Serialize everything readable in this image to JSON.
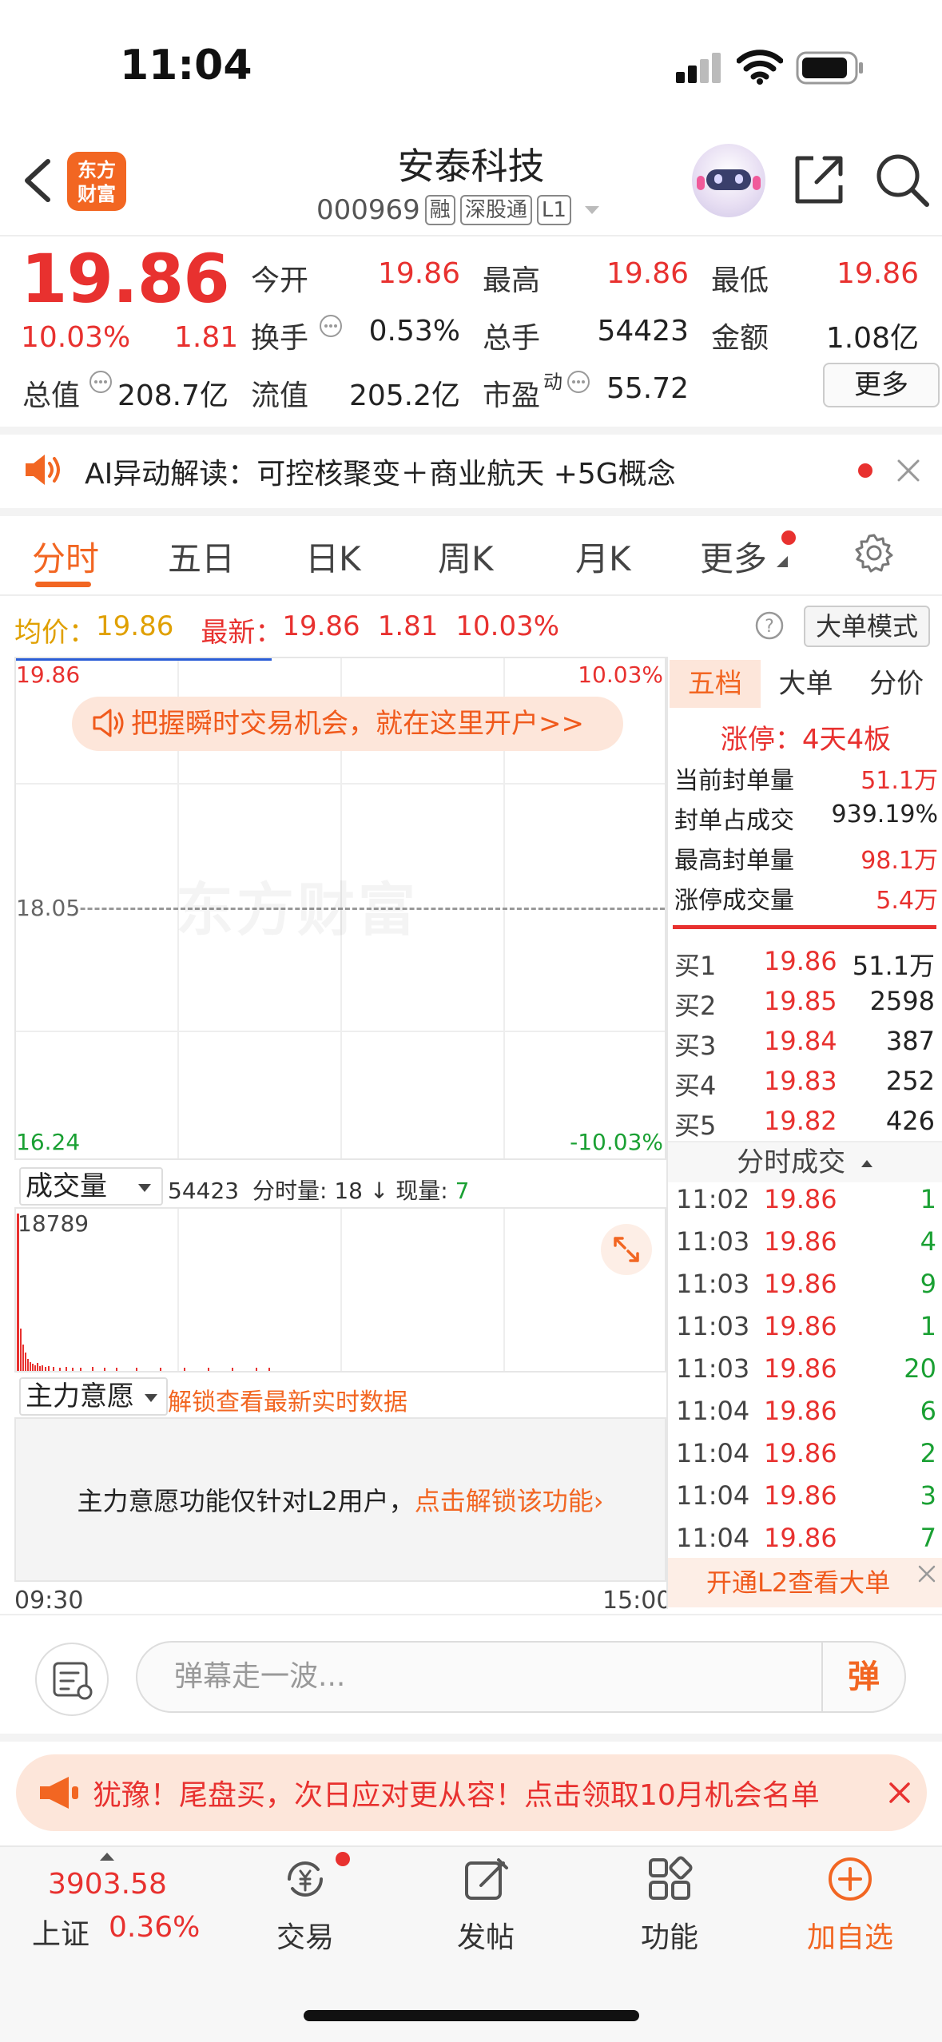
{
  "status_bar": {
    "time": "11:04"
  },
  "header": {
    "logo_text": "东方财富",
    "stock_name": "安泰科技",
    "stock_code": "000969",
    "tags": [
      "融",
      "深股通",
      "L1"
    ]
  },
  "quote": {
    "price": "19.86",
    "change_pct": "10.03%",
    "change": "1.81",
    "fields": {
      "open_label": "今开",
      "open": "19.86",
      "high_label": "最高",
      "high": "19.86",
      "low_label": "最低",
      "low": "19.86",
      "turnover_label": "换手",
      "turnover": "0.53%",
      "volume_label": "总手",
      "volume": "54423",
      "amount_label": "金额",
      "amount": "1.08亿",
      "total_cap_label": "总值",
      "total_cap": "208.7亿",
      "float_cap_label": "流值",
      "float_cap": "205.2亿",
      "pe_label": "市盈",
      "pe_sup": "动",
      "pe": "55.72"
    },
    "more_button": "更多"
  },
  "ai_bar": {
    "text": "AI异动解读：可控核聚变＋商业航天 +5G概念"
  },
  "tabs": [
    "分时",
    "五日",
    "日K",
    "周K",
    "月K",
    "更多"
  ],
  "info_line": {
    "avg_label": "均价：",
    "avg": "19.86",
    "latest_label": "最新：",
    "latest": "19.86",
    "change": "1.81",
    "pct": "10.03%",
    "mode_button": "大单模式"
  },
  "chart": {
    "top_price": "19.86",
    "top_pct": "10.03%",
    "mid_price": "18.05",
    "bottom_price": "16.24",
    "bottom_pct": "-10.03%",
    "watermark": "东方财富",
    "promo": "把握瞬时交易机会，就在这里开户>>"
  },
  "volume": {
    "selector": "成交量",
    "total": "54423",
    "minute_label": "分时量:",
    "minute": "18",
    "current_label": "现量:",
    "current": "7",
    "max": "18789"
  },
  "main_force": {
    "selector": "主力意愿",
    "unlock_hint": "解锁查看最新实时数据",
    "lock_text": "主力意愿功能仅针对L2用户，",
    "lock_link": "点击解锁该功能",
    "time_start": "09:30",
    "time_end": "15:00"
  },
  "right_panel": {
    "tabs": [
      "五档",
      "大单",
      "分价"
    ],
    "limit_up": "涨停：4天4板",
    "seal_rows": [
      {
        "label": "当前封单量",
        "value": "51.1万"
      },
      {
        "label": "封单占成交",
        "value": "939.19%"
      },
      {
        "label": "最高封单量",
        "value": "98.1万"
      },
      {
        "label": "涨停成交量",
        "value": "5.4万"
      }
    ],
    "order_book": [
      {
        "label": "买1",
        "price": "19.86",
        "qty": "51.1万"
      },
      {
        "label": "买2",
        "price": "19.85",
        "qty": "2598"
      },
      {
        "label": "买3",
        "price": "19.84",
        "qty": "387"
      },
      {
        "label": "买4",
        "price": "19.83",
        "qty": "252"
      },
      {
        "label": "买5",
        "price": "19.82",
        "qty": "426"
      }
    ],
    "trades_title": "分时成交",
    "trades": [
      {
        "time": "11:02",
        "price": "19.86",
        "qty": "1"
      },
      {
        "time": "11:03",
        "price": "19.86",
        "qty": "4"
      },
      {
        "time": "11:03",
        "price": "19.86",
        "qty": "9"
      },
      {
        "time": "11:03",
        "price": "19.86",
        "qty": "1"
      },
      {
        "time": "11:03",
        "price": "19.86",
        "qty": "20"
      },
      {
        "time": "11:04",
        "price": "19.86",
        "qty": "6"
      },
      {
        "time": "11:04",
        "price": "19.86",
        "qty": "2"
      },
      {
        "time": "11:04",
        "price": "19.86",
        "qty": "3"
      },
      {
        "time": "11:04",
        "price": "19.86",
        "qty": "7"
      }
    ],
    "l2_promo": "开通L2查看大单"
  },
  "comment": {
    "placeholder": "弹幕走一波...",
    "danmu_button": "弹"
  },
  "ad": {
    "text": "犹豫！尾盘买，次日应对更从容！点击领取10月机会名单"
  },
  "bottom_nav": {
    "index_value": "3903.58",
    "index_name": "上证",
    "index_pct": "0.36%",
    "items": [
      "交易",
      "发帖",
      "功能",
      "加自选"
    ]
  },
  "colors": {
    "up": "#e8312f",
    "down": "#1aa033",
    "accent": "#f26622"
  }
}
